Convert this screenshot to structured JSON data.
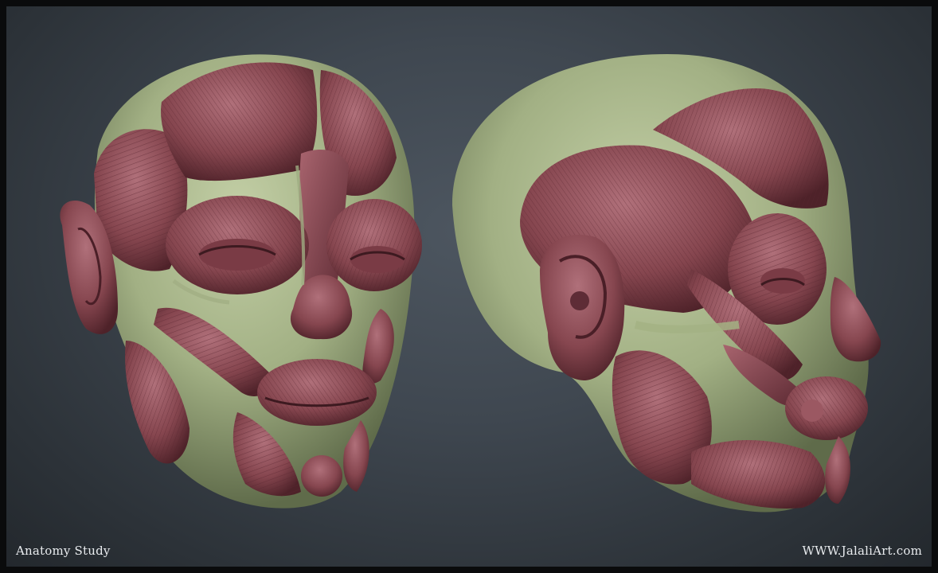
{
  "captions": {
    "title": "Anatomy Study",
    "website": "WWW.JalaliArt.com"
  },
  "colors": {
    "background": "#3f4750",
    "frame": "#0a0b0c",
    "muscle": "#8a4a55",
    "muscle_dark": "#5e2c36",
    "muscle_light": "#b8737d",
    "skull_green": "#a7b58c",
    "caption_text": "#e9ecef"
  },
  "subjects": [
    {
      "name": "front-three-quarter-head"
    },
    {
      "name": "side-profile-head"
    }
  ]
}
